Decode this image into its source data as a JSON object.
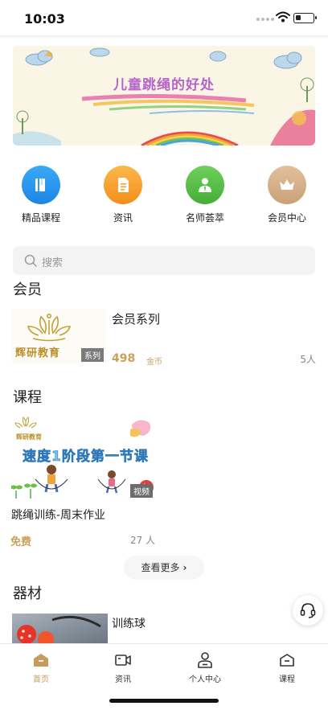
{
  "status_bar": {
    "time": "10:03"
  },
  "banner": {
    "title": "儿童跳绳的好处"
  },
  "quick_nav": [
    {
      "label": "精品课程",
      "icon": "book-icon",
      "color": "#2d9bf0"
    },
    {
      "label": "资讯",
      "icon": "document-icon",
      "color": "#f7a233"
    },
    {
      "label": "名师荟萃",
      "icon": "teacher-icon",
      "color": "#5cc34b"
    },
    {
      "label": "会员中心",
      "icon": "crown-icon",
      "color": "#c9a177"
    }
  ],
  "search": {
    "placeholder": "搜索"
  },
  "member_section": {
    "title": "会员",
    "item": {
      "title": "会员系列",
      "price": "498",
      "unit": "金币",
      "count": "5人",
      "tag": "系列",
      "brand": "辉研教育"
    }
  },
  "course_section": {
    "title": "课程",
    "item": {
      "title": "跳绳训练-周末作业",
      "price": "免费",
      "count": "27 人",
      "tag": "视频",
      "thumb_text": "速度1阶段第一节课",
      "brand": "辉研教育"
    },
    "more_label": "查看更多"
  },
  "equipment_section": {
    "title": "器材",
    "item": {
      "title": "训练球"
    }
  },
  "tab_bar": [
    {
      "label": "首页",
      "active": true
    },
    {
      "label": "资讯",
      "active": false
    },
    {
      "label": "个人中心",
      "active": false
    },
    {
      "label": "课程",
      "active": false
    }
  ],
  "colors": {
    "accent": "#c59b5e",
    "price": "#c9a15b"
  }
}
